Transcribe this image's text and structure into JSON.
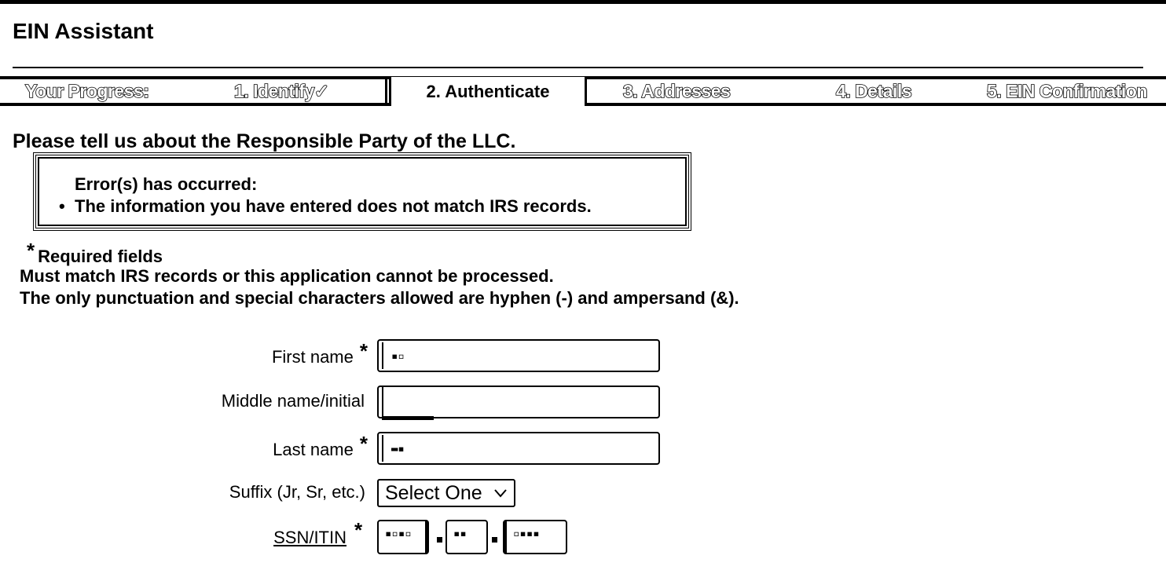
{
  "app": {
    "title": "EIN Assistant"
  },
  "progress": {
    "label": "Your Progress:",
    "steps": [
      {
        "label": "1. Identify",
        "check": "✓",
        "state": "done"
      },
      {
        "label": "2. Authenticate",
        "state": "current"
      },
      {
        "label": "3. Addresses",
        "state": "todo"
      },
      {
        "label": "4. Details",
        "state": "todo"
      },
      {
        "label": "5. EIN Confirmation",
        "state": "todo"
      }
    ]
  },
  "page": {
    "heading": "Please tell us about the Responsible Party of the LLC."
  },
  "error": {
    "title": "Error(s) has occurred:",
    "bullet": "•",
    "items": [
      "The information you have entered does not match IRS records."
    ]
  },
  "notes": {
    "required_star": "*",
    "required": "Required fields",
    "line1": "Must match IRS records or this application cannot be processed.",
    "line2": "The only punctuation and special characters allowed are hyphen (-) and ampersand (&)."
  },
  "form": {
    "first_name": {
      "label": "First name",
      "required": "*",
      "value": ""
    },
    "middle_name": {
      "label": "Middle name/initial",
      "value": ""
    },
    "last_name": {
      "label": "Last name",
      "required": "*",
      "value": ""
    },
    "suffix": {
      "label": "Suffix (Jr, Sr, etc.)",
      "selected": "Select One"
    },
    "ssn": {
      "label": "SSN/ITIN",
      "required": "*"
    }
  },
  "colors": {
    "text": "#000000",
    "background": "#ffffff"
  }
}
